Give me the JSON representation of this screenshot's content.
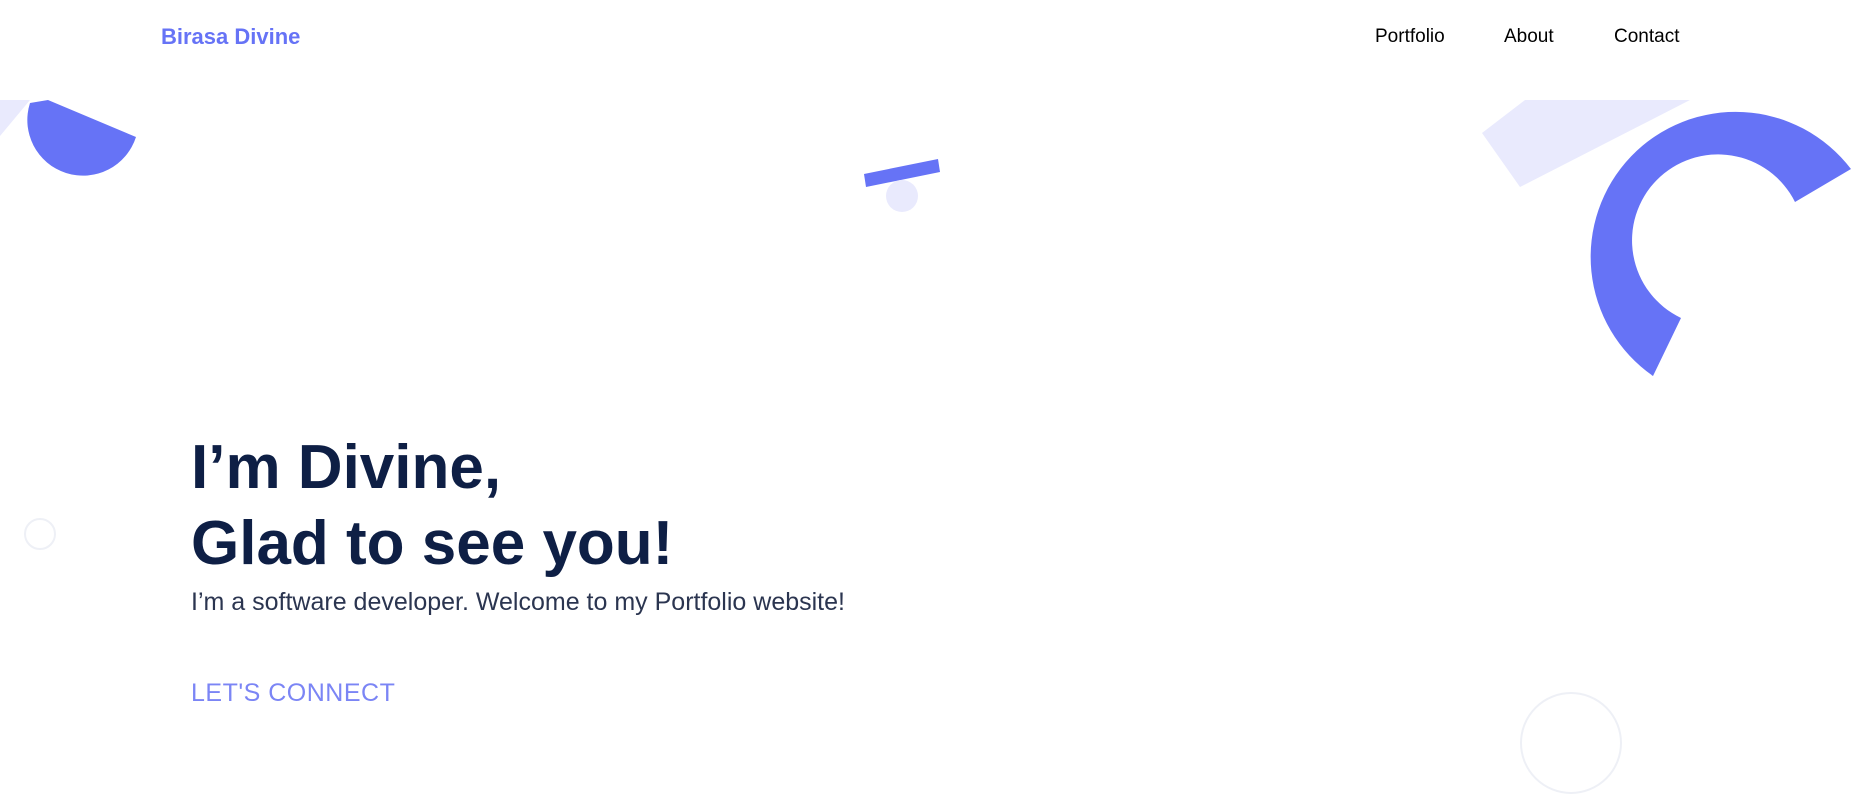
{
  "brand": {
    "name": "Birasa Divine"
  },
  "nav": {
    "items": [
      {
        "label": "Portfolio"
      },
      {
        "label": "About"
      },
      {
        "label": "Contact"
      }
    ]
  },
  "hero": {
    "title_line1": "I’m Divine,",
    "title_line2": "Glad to see you!",
    "subtitle": "I’m a software developer. Welcome to my Portfolio website!",
    "cta_label": "LET'S CONNECT"
  },
  "colors": {
    "accent": "#6673f6",
    "accent_light": "#e9eafd",
    "heading": "#0e1f45",
    "cta": "#7b85f5"
  }
}
